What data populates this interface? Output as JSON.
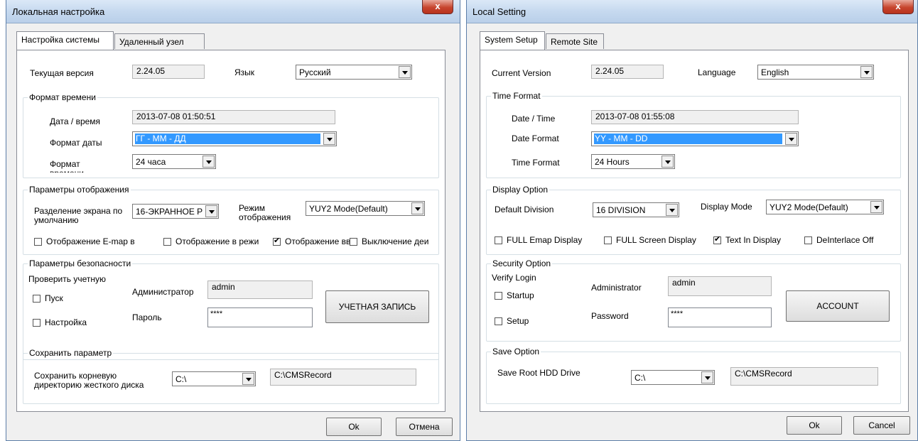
{
  "left": {
    "title": "Локальная настройка",
    "close": "x",
    "tabs": [
      "Настройка системы",
      "Удаленный узел"
    ],
    "current_version_label": "Текущая версия",
    "current_version": "2.24.05",
    "language_label": "Язык",
    "language": "Русский",
    "time_group": "Формат времени",
    "datetime_label": "Дата / время",
    "datetime": "2013-07-08  01:50:51",
    "date_format_label": "Формат даты",
    "date_format": "ГГ - ММ - ДД",
    "time_format_label": "Формат времени",
    "time_format": "24 часа",
    "display_group": "Параметры отображения",
    "division_label": "Разделение экрана по умолчанию",
    "division": "16-ЭКРАННОЕ Р",
    "display_mode_label": "Режим отображения",
    "display_mode": "YUY2 Mode(Default)",
    "checks": [
      "Отображение E-map в",
      "Отображение в режи",
      "Отображение вво",
      "Выключение деи"
    ],
    "security_group": "Параметры безопасности",
    "verify_label": "Проверить учетную",
    "startup": "Пуск",
    "setup": "Настройка",
    "admin_label": "Администратор",
    "admin": "admin",
    "password_label": "Пароль",
    "password": "****",
    "account_button": "УЧЕТНАЯ ЗАПИСЬ",
    "save_group": "Сохранить параметр",
    "save_label": "Сохранить корневую директорию жесткого диска",
    "drive": "C:\\",
    "save_path": "C:\\CMSRecord",
    "ok": "Ok",
    "cancel": "Отмена"
  },
  "right": {
    "title": "Local Setting",
    "close": "x",
    "tabs": [
      "System Setup",
      "Remote Site"
    ],
    "current_version_label": "Current Version",
    "current_version": "2.24.05",
    "language_label": "Language",
    "language": "English",
    "time_group": "Time Format",
    "datetime_label": "Date / Time",
    "datetime": "2013-07-08  01:55:08",
    "date_format_label": "Date Format",
    "date_format": "YY - MM - DD",
    "time_format_label": "Time Format",
    "time_format": "24 Hours",
    "display_group": "Display Option",
    "division_label": "Default Division",
    "division": "16 DIVISION",
    "display_mode_label": "Display Mode",
    "display_mode": "YUY2 Mode(Default)",
    "checks": [
      "FULL Emap Display",
      "FULL Screen Display",
      "Text In Display",
      "DeInterlace Off"
    ],
    "security_group": "Security Option",
    "verify_label": "Verify Login",
    "startup": "Startup",
    "setup": "Setup",
    "admin_label": "Administrator",
    "admin": "admin",
    "password_label": "Password",
    "password": "****",
    "account_button": "ACCOUNT",
    "save_group": "Save Option",
    "save_label": "Save Root HDD Drive",
    "drive": "C:\\",
    "save_path": "C:\\CMSRecord",
    "ok": "Ok",
    "cancel": "Cancel"
  },
  "checked": [
    false,
    false,
    true,
    false
  ]
}
